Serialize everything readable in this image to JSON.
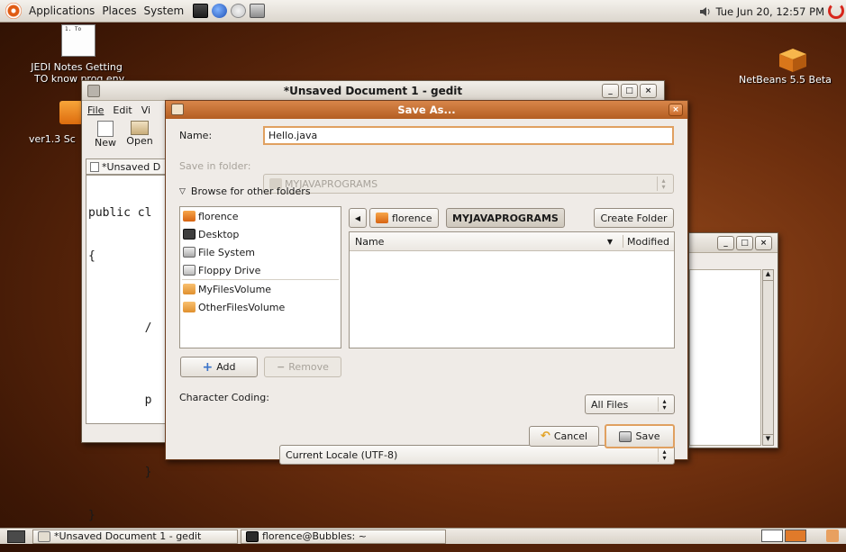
{
  "top_panel": {
    "menus": [
      "Applications",
      "Places",
      "System"
    ],
    "clock": "Tue Jun 20, 12:57 PM"
  },
  "desktop": {
    "doc_icon_text": "1. To",
    "jedi_label_line1": "JEDI Notes Getting",
    "jedi_label_line2": "TO know prog env",
    "ver_label": "ver1.3 Sc",
    "netbeans_label": "NetBeans 5.5 Beta"
  },
  "gedit": {
    "title": "*Unsaved Document 1 - gedit",
    "menu_file": "File",
    "menu_edit": "Edit",
    "menu_view": "Vi",
    "tool_new": "New",
    "tool_open": "Open",
    "tab_label": "*Unsaved D",
    "code_lines": [
      "public cl",
      "{",
      "",
      "        /",
      "",
      "        p",
      "",
      "        }",
      "}"
    ]
  },
  "dialog": {
    "title": "Save As...",
    "name_label": "Name:",
    "name_value": "Hello.java",
    "save_in_label": "Save in folder:",
    "save_in_value": "MYJAVAPROGRAMS",
    "browse_label": "Browse for other folders",
    "places": [
      {
        "label": "florence",
        "icon": "home-folder-icon"
      },
      {
        "label": "Desktop",
        "icon": "desktop-icon"
      },
      {
        "label": "File System",
        "icon": "harddisk-icon"
      },
      {
        "label": "Floppy Drive",
        "icon": "floppy-icon"
      },
      {
        "label": "MyFilesVolume",
        "icon": "folder-icon"
      },
      {
        "label": "OtherFilesVolume",
        "icon": "folder-icon"
      }
    ],
    "path_segments": [
      "florence",
      "MYJAVAPROGRAMS"
    ],
    "create_folder": "Create Folder",
    "col_name": "Name",
    "col_modified": "Modified",
    "add_label": "Add",
    "remove_label": "Remove",
    "filter_value": "All Files",
    "char_coding_label": "Character Coding:",
    "char_coding_value": "Current Locale (UTF-8)",
    "cancel_label": "Cancel",
    "save_label": "Save"
  },
  "taskbar": {
    "tasks": [
      "*Unsaved Document 1 - gedit",
      "florence@Bubbles: ~"
    ]
  },
  "colors": {
    "dialog_title": "#c36e31",
    "focus_ring": "#e0a060"
  }
}
